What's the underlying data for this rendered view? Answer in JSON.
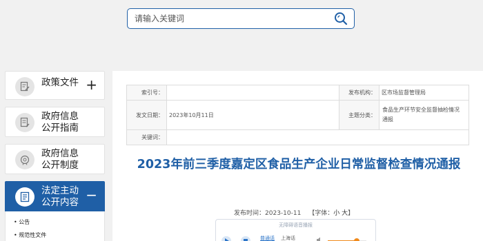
{
  "search": {
    "placeholder": "请输入关键词"
  },
  "sidebar": {
    "items": [
      {
        "label": "政策文件",
        "toggle": "+",
        "icon": "document-edit-icon"
      },
      {
        "label_line1": "政府信息",
        "label_line2": "公开指南",
        "icon": "document-guide-icon"
      },
      {
        "label_line1": "政府信息",
        "label_line2": "公开制度",
        "icon": "badge-seal-icon"
      },
      {
        "label_line1": "法定主动",
        "label_line2": "公开内容",
        "toggle": "−",
        "icon": "list-document-icon",
        "sub": [
          "公告",
          "规范性文件"
        ]
      }
    ]
  },
  "meta": {
    "index_label": "索引号：",
    "index_value": "",
    "org_label": "发布机构：",
    "org_value": "区市场监督管理局",
    "date_label": "发文日期：",
    "date_value": "2023年10月11日",
    "category_label": "主题分类：",
    "category_value": "食品生产环节安全监督抽检情况通报",
    "keyword_label": "关键词：",
    "keyword_value": ""
  },
  "article": {
    "title": "2023年前三季度嘉定区食品生产企业日常监督检查情况通报",
    "pubtime_label": "发布时间：",
    "pubtime": "2023-10-11",
    "fontsize_open": "【字体：",
    "font_small": "小",
    "font_large": "大",
    "fontsize_close": "】"
  },
  "audio": {
    "title": "无障碍语音播报",
    "lang1": "普通话",
    "lang2": "上海话",
    "progress": 0.75
  },
  "colors": {
    "accent": "#1f5fa6",
    "audio_orange": "#f08a1c"
  }
}
